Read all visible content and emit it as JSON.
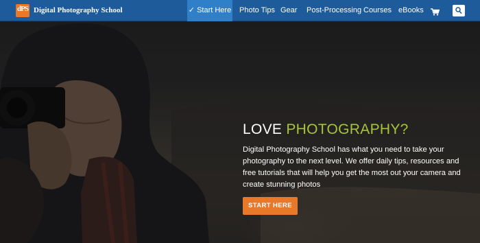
{
  "header": {
    "logo_text": "dPS",
    "site_name": "Digital Photography School",
    "nav": [
      {
        "label": "✓ Start Here",
        "active": true
      },
      {
        "label": "Photo Tips"
      },
      {
        "label": "Gear"
      },
      {
        "label": "Post-Processing"
      },
      {
        "label": "Courses"
      },
      {
        "label": "eBooks"
      }
    ],
    "cart_icon": "shopping-cart-icon",
    "search_icon": "search-icon"
  },
  "hero": {
    "headline_prefix": "LOVE ",
    "headline_accent": "PHOTOGRAPHY?",
    "text": "Digital Photography School has what you need to take your photography to the next level. We offer daily tips, resources and free tutorials that will help you get the most out your camera and create stunning photos",
    "cta_label": "START HERE"
  },
  "colors": {
    "nav_bg": "#1d5b9b",
    "nav_active": "#2f80c9",
    "accent_green": "#a7c43a",
    "accent_orange": "#e8782a"
  }
}
